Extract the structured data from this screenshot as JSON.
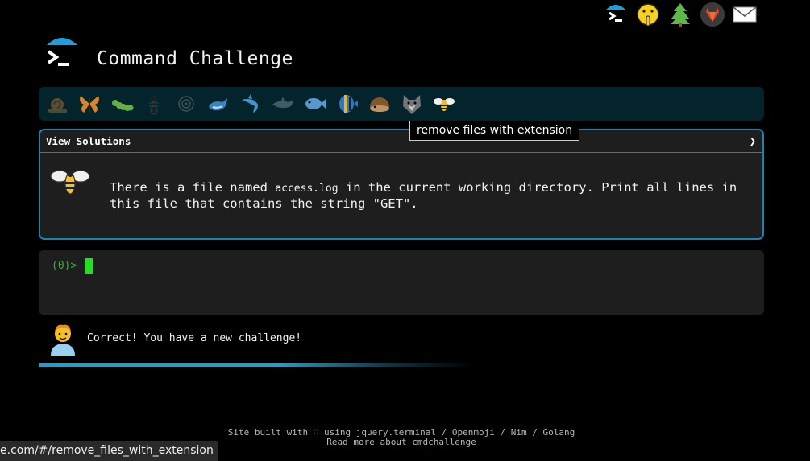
{
  "app": {
    "title": "Command Challenge"
  },
  "top_nav": {
    "icons": [
      "terminal-umbrella-icon",
      "shushing-face-icon",
      "tree-icon",
      "gitlab-icon",
      "mail-icon"
    ]
  },
  "levels": {
    "icons": [
      "snail-icon",
      "butterfly-icon",
      "caterpillar-icon",
      "ant-icon",
      "spiral-shell-icon",
      "whale-icon",
      "shark-icon",
      "dolphin-icon",
      "fish-icon",
      "tropical-fish-icon",
      "hedgehog-icon",
      "wolf-icon",
      "bee-icon"
    ],
    "tooltip": "remove files with extension"
  },
  "challenge": {
    "view_solutions_label": "View Solutions",
    "toggle_glyph": "❯",
    "text_before": "There is a file named ",
    "file_name": "access.log",
    "text_after": " in the current working directory. Print all lines in this file that contains the string \"GET\"."
  },
  "terminal": {
    "prompt": "(0)>"
  },
  "feedback": {
    "message": "Correct! You have a new challenge!"
  },
  "footer": {
    "line1": "Site built with ♡ using jquery.terminal / Openmoji / Nim / Golang",
    "line2": "Read more about cmdchallenge"
  },
  "status_url": "e.com/#/remove_files_with_extension",
  "colors": {
    "accent": "#1a84ad",
    "prompt_green": "#2fb82f",
    "level_bar_bg": "#04242c",
    "panel_bg": "#1e1e1e"
  }
}
